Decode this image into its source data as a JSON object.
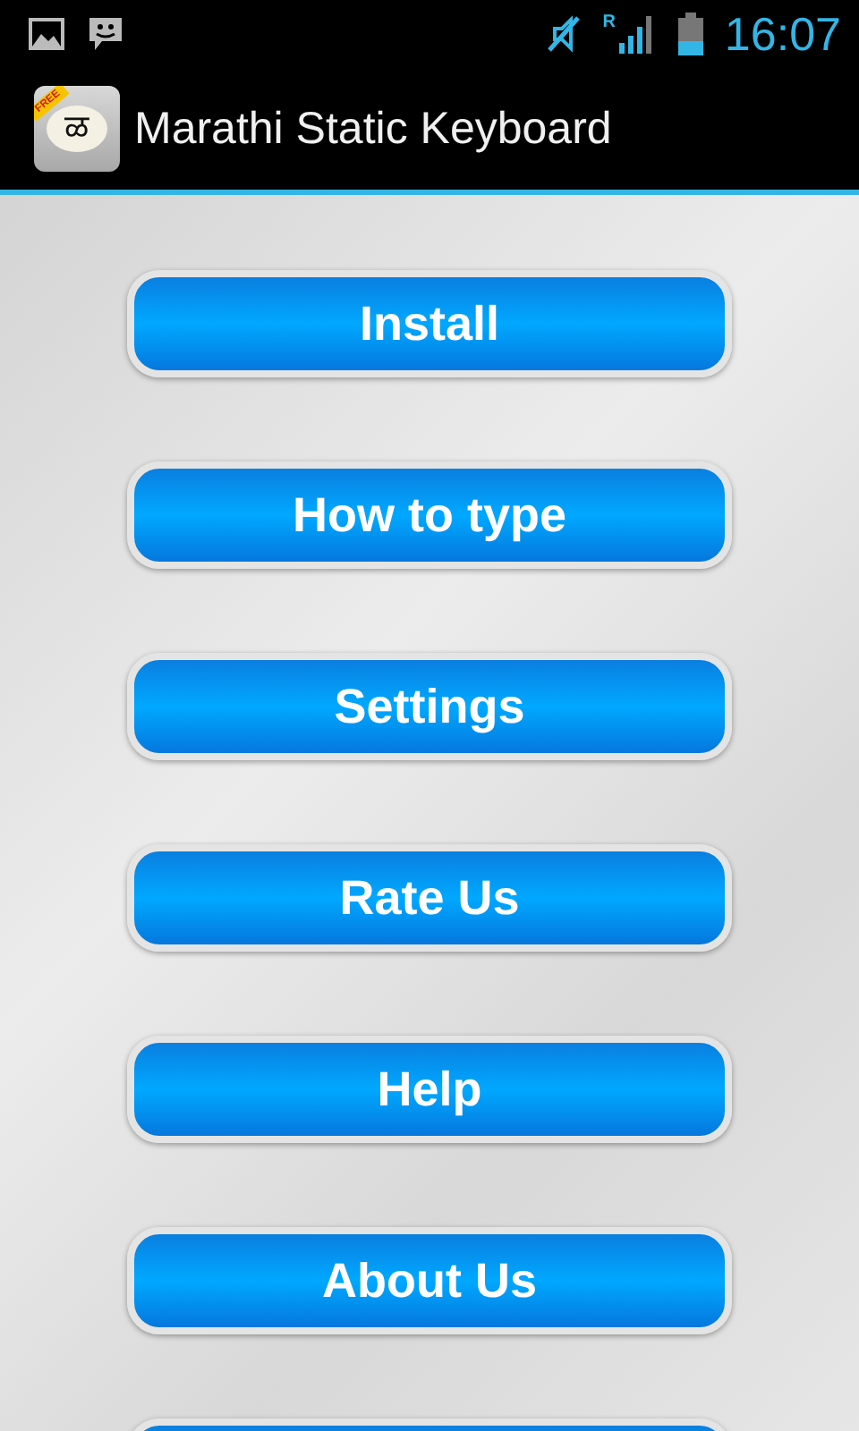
{
  "status_bar": {
    "roaming": "R",
    "time": "16:07"
  },
  "action_bar": {
    "app_icon": {
      "badge": "FREE",
      "glyph": "ळ"
    },
    "title": "Marathi Static Keyboard"
  },
  "buttons": [
    {
      "label": "Install"
    },
    {
      "label": "How to type"
    },
    {
      "label": "Settings"
    },
    {
      "label": "Rate Us"
    },
    {
      "label": "Help"
    },
    {
      "label": "About Us"
    }
  ],
  "more_below": true
}
